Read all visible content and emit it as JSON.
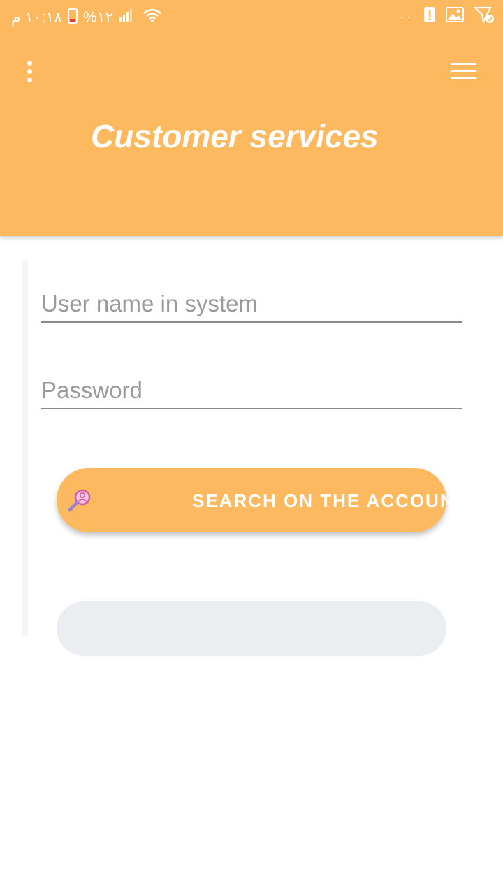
{
  "status_bar": {
    "time": "١٠:١٨ م",
    "battery": "%١٢",
    "overflow_dots": "··"
  },
  "header": {
    "title": "Customer services"
  },
  "form": {
    "username_placeholder": "User name in system",
    "password_placeholder": "Password",
    "search_button_label": "SEARCH ON THE ACCOUNT"
  },
  "colors": {
    "accent": "#fdb95f",
    "pill": "#eaeef1"
  },
  "icons": {
    "menu": "more-vert-icon",
    "nav": "hamburger-menu-icon",
    "search_account": "search-person-icon"
  }
}
